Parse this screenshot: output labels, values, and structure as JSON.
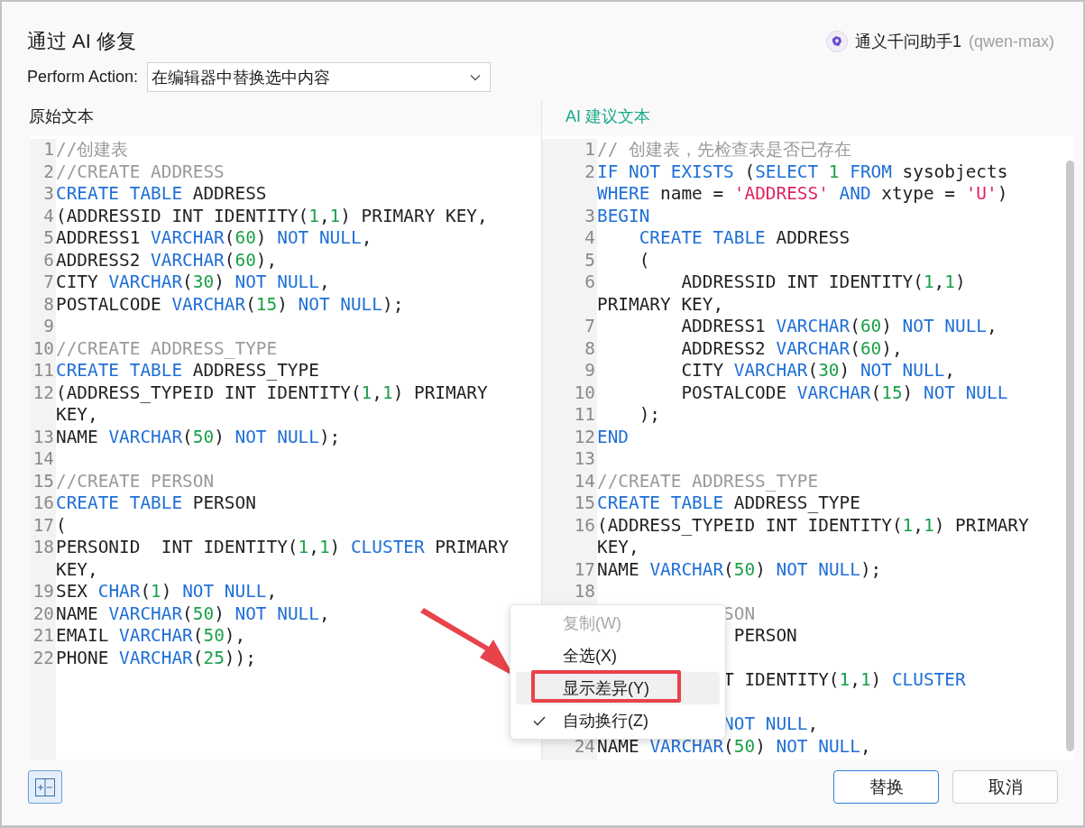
{
  "dialog": {
    "title": "通过 AI 修复"
  },
  "assistant": {
    "name": "通义千问助手1",
    "model": "(qwen-max)"
  },
  "action": {
    "label": "Perform Action:",
    "value": "在编辑器中替换选中内容"
  },
  "original": {
    "label": "原始文本",
    "rows": [
      {
        "no": "1",
        "code": [
          {
            "kind": "cmt",
            "text": "//创建表"
          }
        ]
      },
      {
        "no": "2",
        "code": [
          {
            "kind": "cmt",
            "text": "//CREATE ADDRESS"
          }
        ]
      },
      {
        "no": "3",
        "code": [
          {
            "kind": "kw",
            "text": "CREATE TABLE"
          },
          {
            "kind": "txt",
            "text": " ADDRESS"
          }
        ]
      },
      {
        "no": "4",
        "code": [
          {
            "kind": "txt",
            "text": "(ADDRESSID INT IDENTITY("
          },
          {
            "kind": "num",
            "text": "1"
          },
          {
            "kind": "txt",
            "text": ","
          },
          {
            "kind": "num",
            "text": "1"
          },
          {
            "kind": "txt",
            "text": ") PRIMARY KEY,"
          }
        ]
      },
      {
        "no": "5",
        "code": [
          {
            "kind": "txt",
            "text": "ADDRESS1 "
          },
          {
            "kind": "kw",
            "text": "VARCHAR"
          },
          {
            "kind": "txt",
            "text": "("
          },
          {
            "kind": "num",
            "text": "60"
          },
          {
            "kind": "txt",
            "text": ") "
          },
          {
            "kind": "kw",
            "text": "NOT NULL"
          },
          {
            "kind": "txt",
            "text": ","
          }
        ]
      },
      {
        "no": "6",
        "code": [
          {
            "kind": "txt",
            "text": "ADDRESS2 "
          },
          {
            "kind": "kw",
            "text": "VARCHAR"
          },
          {
            "kind": "txt",
            "text": "("
          },
          {
            "kind": "num",
            "text": "60"
          },
          {
            "kind": "txt",
            "text": "),"
          }
        ]
      },
      {
        "no": "7",
        "code": [
          {
            "kind": "txt",
            "text": "CITY "
          },
          {
            "kind": "kw",
            "text": "VARCHAR"
          },
          {
            "kind": "txt",
            "text": "("
          },
          {
            "kind": "num",
            "text": "30"
          },
          {
            "kind": "txt",
            "text": ") "
          },
          {
            "kind": "kw",
            "text": "NOT NULL"
          },
          {
            "kind": "txt",
            "text": ","
          }
        ]
      },
      {
        "no": "8",
        "code": [
          {
            "kind": "txt",
            "text": "POSTALCODE "
          },
          {
            "kind": "kw",
            "text": "VARCHAR"
          },
          {
            "kind": "txt",
            "text": "("
          },
          {
            "kind": "num",
            "text": "15"
          },
          {
            "kind": "txt",
            "text": ") "
          },
          {
            "kind": "kw",
            "text": "NOT NULL"
          },
          {
            "kind": "txt",
            "text": ");"
          }
        ]
      },
      {
        "no": "9"
      },
      {
        "no": "10",
        "code": [
          {
            "kind": "cmt",
            "text": "//CREATE ADDRESS_TYPE"
          }
        ]
      },
      {
        "no": "11",
        "code": [
          {
            "kind": "kw",
            "text": "CREATE TABLE"
          },
          {
            "kind": "txt",
            "text": " ADDRESS_TYPE"
          }
        ]
      },
      {
        "no": "12",
        "code": [
          {
            "kind": "txt",
            "text": "(ADDRESS_TYPEID INT IDENTITY("
          },
          {
            "kind": "num",
            "text": "1"
          },
          {
            "kind": "txt",
            "text": ","
          },
          {
            "kind": "num",
            "text": "1"
          },
          {
            "kind": "txt",
            "text": ") PRIMARY"
          }
        ]
      },
      {
        "code": [
          {
            "kind": "txt",
            "text": "KEY,"
          }
        ]
      },
      {
        "no": "13",
        "code": [
          {
            "kind": "txt",
            "text": "NAME "
          },
          {
            "kind": "kw",
            "text": "VARCHAR"
          },
          {
            "kind": "txt",
            "text": "("
          },
          {
            "kind": "num",
            "text": "50"
          },
          {
            "kind": "txt",
            "text": ") "
          },
          {
            "kind": "kw",
            "text": "NOT NULL"
          },
          {
            "kind": "txt",
            "text": ");"
          }
        ]
      },
      {
        "no": "14"
      },
      {
        "no": "15",
        "code": [
          {
            "kind": "cmt",
            "text": "//CREATE PERSON"
          }
        ]
      },
      {
        "no": "16",
        "code": [
          {
            "kind": "kw",
            "text": "CREATE TABLE"
          },
          {
            "kind": "txt",
            "text": " PERSON"
          }
        ]
      },
      {
        "no": "17",
        "code": [
          {
            "kind": "txt",
            "text": "("
          }
        ]
      },
      {
        "no": "18",
        "code": [
          {
            "kind": "txt",
            "text": "PERSONID  INT IDENTITY("
          },
          {
            "kind": "num",
            "text": "1"
          },
          {
            "kind": "txt",
            "text": ","
          },
          {
            "kind": "num",
            "text": "1"
          },
          {
            "kind": "txt",
            "text": ") "
          },
          {
            "kind": "kw",
            "text": "CLUSTER"
          },
          {
            "kind": "txt",
            "text": " PRIMARY"
          }
        ]
      },
      {
        "code": [
          {
            "kind": "txt",
            "text": "KEY,"
          }
        ]
      },
      {
        "no": "19",
        "code": [
          {
            "kind": "txt",
            "text": "SEX "
          },
          {
            "kind": "kw",
            "text": "CHAR"
          },
          {
            "kind": "txt",
            "text": "("
          },
          {
            "kind": "num",
            "text": "1"
          },
          {
            "kind": "txt",
            "text": ") "
          },
          {
            "kind": "kw",
            "text": "NOT NULL"
          },
          {
            "kind": "txt",
            "text": ","
          }
        ]
      },
      {
        "no": "20",
        "code": [
          {
            "kind": "txt",
            "text": "NAME "
          },
          {
            "kind": "kw",
            "text": "VARCHAR"
          },
          {
            "kind": "txt",
            "text": "("
          },
          {
            "kind": "num",
            "text": "50"
          },
          {
            "kind": "txt",
            "text": ") "
          },
          {
            "kind": "kw",
            "text": "NOT NULL"
          },
          {
            "kind": "txt",
            "text": ","
          }
        ]
      },
      {
        "no": "21",
        "code": [
          {
            "kind": "txt",
            "text": "EMAIL "
          },
          {
            "kind": "kw",
            "text": "VARCHAR"
          },
          {
            "kind": "txt",
            "text": "("
          },
          {
            "kind": "num",
            "text": "50"
          },
          {
            "kind": "txt",
            "text": "),"
          }
        ]
      },
      {
        "no": "22",
        "code": [
          {
            "kind": "txt",
            "text": "PHONE "
          },
          {
            "kind": "kw",
            "text": "VARCHAR"
          },
          {
            "kind": "txt",
            "text": "("
          },
          {
            "kind": "num",
            "text": "25"
          },
          {
            "kind": "txt",
            "text": "));"
          }
        ]
      }
    ]
  },
  "suggested": {
    "label": "AI 建议文本",
    "rows": [
      {
        "no": "1",
        "code": [
          {
            "kind": "cmt",
            "text": "// 创建表，先检查表是否已存在"
          }
        ]
      },
      {
        "no": "2",
        "code": [
          {
            "kind": "kw",
            "text": "IF NOT EXISTS"
          },
          {
            "kind": "txt",
            "text": " ("
          },
          {
            "kind": "kw",
            "text": "SELECT"
          },
          {
            "kind": "num",
            "text": " 1"
          },
          {
            "kind": "kw",
            "text": " FROM"
          },
          {
            "kind": "txt",
            "text": " sysobjects"
          }
        ]
      },
      {
        "code": [
          {
            "kind": "kw",
            "text": "WHERE"
          },
          {
            "kind": "txt",
            "text": " name = "
          },
          {
            "kind": "str",
            "text": "'ADDRESS'"
          },
          {
            "kind": "kw",
            "text": " AND"
          },
          {
            "kind": "txt",
            "text": " xtype = "
          },
          {
            "kind": "str",
            "text": "'U'"
          },
          {
            "kind": "txt",
            "text": ")"
          }
        ]
      },
      {
        "no": "3",
        "code": [
          {
            "kind": "kw",
            "text": "BEGIN"
          }
        ]
      },
      {
        "no": "4",
        "code": [
          {
            "kind": "kw",
            "text": "    CREATE TABLE"
          },
          {
            "kind": "txt",
            "text": " ADDRESS"
          }
        ]
      },
      {
        "no": "5",
        "code": [
          {
            "kind": "txt",
            "text": "    ("
          }
        ]
      },
      {
        "no": "6",
        "code": [
          {
            "kind": "txt",
            "text": "        ADDRESSID INT IDENTITY("
          },
          {
            "kind": "num",
            "text": "1"
          },
          {
            "kind": "txt",
            "text": ","
          },
          {
            "kind": "num",
            "text": "1"
          },
          {
            "kind": "txt",
            "text": ")"
          }
        ]
      },
      {
        "code": [
          {
            "kind": "txt",
            "text": "PRIMARY KEY,"
          }
        ]
      },
      {
        "no": "7",
        "code": [
          {
            "kind": "txt",
            "text": "        ADDRESS1 "
          },
          {
            "kind": "kw",
            "text": "VARCHAR"
          },
          {
            "kind": "txt",
            "text": "("
          },
          {
            "kind": "num",
            "text": "60"
          },
          {
            "kind": "txt",
            "text": ") "
          },
          {
            "kind": "kw",
            "text": "NOT NULL"
          },
          {
            "kind": "txt",
            "text": ","
          }
        ]
      },
      {
        "no": "8",
        "code": [
          {
            "kind": "txt",
            "text": "        ADDRESS2 "
          },
          {
            "kind": "kw",
            "text": "VARCHAR"
          },
          {
            "kind": "txt",
            "text": "("
          },
          {
            "kind": "num",
            "text": "60"
          },
          {
            "kind": "txt",
            "text": "),"
          }
        ]
      },
      {
        "no": "9",
        "code": [
          {
            "kind": "txt",
            "text": "        CITY "
          },
          {
            "kind": "kw",
            "text": "VARCHAR"
          },
          {
            "kind": "txt",
            "text": "("
          },
          {
            "kind": "num",
            "text": "30"
          },
          {
            "kind": "txt",
            "text": ") "
          },
          {
            "kind": "kw",
            "text": "NOT NULL"
          },
          {
            "kind": "txt",
            "text": ","
          }
        ]
      },
      {
        "no": "10",
        "code": [
          {
            "kind": "txt",
            "text": "        POSTALCODE "
          },
          {
            "kind": "kw",
            "text": "VARCHAR"
          },
          {
            "kind": "txt",
            "text": "("
          },
          {
            "kind": "num",
            "text": "15"
          },
          {
            "kind": "txt",
            "text": ") "
          },
          {
            "kind": "kw",
            "text": "NOT NULL"
          }
        ]
      },
      {
        "no": "11",
        "code": [
          {
            "kind": "txt",
            "text": "    );"
          }
        ]
      },
      {
        "no": "12",
        "code": [
          {
            "kind": "kw",
            "text": "END"
          }
        ]
      },
      {
        "no": "13"
      },
      {
        "no": "14",
        "code": [
          {
            "kind": "cmt",
            "text": "//CREATE ADDRESS_TYPE"
          }
        ]
      },
      {
        "no": "15",
        "code": [
          {
            "kind": "kw",
            "text": "CREATE TABLE"
          },
          {
            "kind": "txt",
            "text": " ADDRESS_TYPE"
          }
        ]
      },
      {
        "no": "16",
        "code": [
          {
            "kind": "txt",
            "text": "(ADDRESS_TYPEID INT IDENTITY("
          },
          {
            "kind": "num",
            "text": "1"
          },
          {
            "kind": "txt",
            "text": ","
          },
          {
            "kind": "num",
            "text": "1"
          },
          {
            "kind": "txt",
            "text": ") PRIMARY"
          }
        ]
      },
      {
        "code": [
          {
            "kind": "txt",
            "text": "KEY,"
          }
        ]
      },
      {
        "no": "17",
        "code": [
          {
            "kind": "txt",
            "text": "NAME "
          },
          {
            "kind": "kw",
            "text": "VARCHAR"
          },
          {
            "kind": "txt",
            "text": "("
          },
          {
            "kind": "num",
            "text": "50"
          },
          {
            "kind": "txt",
            "text": ") "
          },
          {
            "kind": "kw",
            "text": "NOT NULL"
          },
          {
            "kind": "txt",
            "text": ");"
          }
        ]
      },
      {
        "no": "18"
      },
      {
        "code": [
          {
            "kind": "cmt",
            "text": "            SON"
          }
        ]
      },
      {
        "code": [
          {
            "kind": "txt",
            "text": "             PERSON"
          }
        ]
      },
      {},
      {
        "code": [
          {
            "kind": "txt",
            "text": "            T IDENTITY("
          },
          {
            "kind": "num",
            "text": "1"
          },
          {
            "kind": "txt",
            "text": ","
          },
          {
            "kind": "num",
            "text": "1"
          },
          {
            "kind": "txt",
            "text": ") "
          },
          {
            "kind": "kw",
            "text": "CLUSTER"
          }
        ]
      },
      {},
      {
        "code": [
          {
            "kind": "kw",
            "text": "            NOT NULL"
          },
          {
            "kind": "txt",
            "text": ","
          }
        ]
      },
      {
        "no": "24",
        "code": [
          {
            "kind": "txt",
            "text": "NAME "
          },
          {
            "kind": "kw",
            "text": "VARCHAR"
          },
          {
            "kind": "txt",
            "text": "("
          },
          {
            "kind": "num",
            "text": "50"
          },
          {
            "kind": "txt",
            "text": ") "
          },
          {
            "kind": "kw",
            "text": "NOT NULL"
          },
          {
            "kind": "txt",
            "text": ","
          }
        ]
      }
    ]
  },
  "context_menu": {
    "items": [
      {
        "label": "复制(W)",
        "disabled": true,
        "checked": false,
        "selected": false
      },
      {
        "label": "全选(X)",
        "disabled": false,
        "checked": false,
        "selected": false
      },
      {
        "label": "显示差异(Y)",
        "disabled": false,
        "checked": false,
        "selected": true
      },
      {
        "label": "自动换行(Z)",
        "disabled": false,
        "checked": true,
        "selected": false
      }
    ]
  },
  "buttons": [
    {
      "label": "替换",
      "primary": true
    },
    {
      "label": "取消",
      "primary": false
    }
  ]
}
